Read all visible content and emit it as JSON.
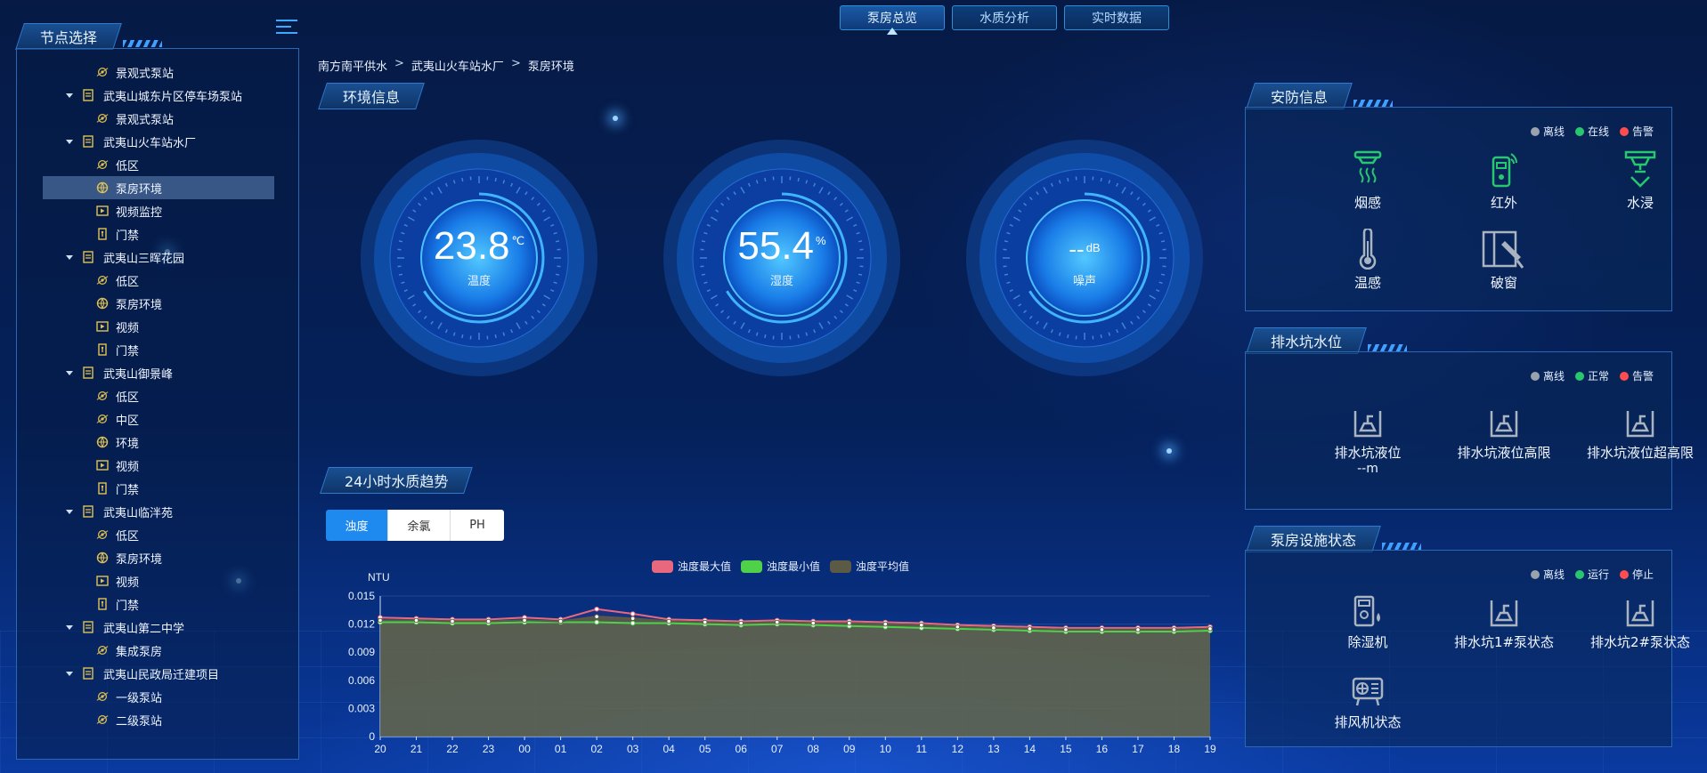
{
  "top_tabs": [
    {
      "label": "泵房总览",
      "active": true
    },
    {
      "label": "水质分析",
      "active": false
    },
    {
      "label": "实时数据",
      "active": false
    }
  ],
  "left": {
    "title": "节点选择",
    "tree": [
      {
        "level": 2,
        "label": "景观式泵站",
        "icon": "pump-icon"
      },
      {
        "level": 1,
        "label": "武夷山城东片区停车场泵站",
        "icon": "folder-icon"
      },
      {
        "level": 2,
        "label": "景观式泵站",
        "icon": "pump-icon"
      },
      {
        "level": 1,
        "label": "武夷山火车站水厂",
        "icon": "folder-icon"
      },
      {
        "level": 2,
        "label": "低区",
        "icon": "pump-icon"
      },
      {
        "level": 2,
        "label": "泵房环境",
        "icon": "environment-icon",
        "selected": true
      },
      {
        "level": 2,
        "label": "视频监控",
        "icon": "video-icon"
      },
      {
        "level": 2,
        "label": "门禁",
        "icon": "door-icon"
      },
      {
        "level": 1,
        "label": "武夷山三晖花园",
        "icon": "folder-icon"
      },
      {
        "level": 2,
        "label": "低区",
        "icon": "pump-icon"
      },
      {
        "level": 2,
        "label": "泵房环境",
        "icon": "environment-icon"
      },
      {
        "level": 2,
        "label": "视频",
        "icon": "video-icon"
      },
      {
        "level": 2,
        "label": "门禁",
        "icon": "door-icon"
      },
      {
        "level": 1,
        "label": "武夷山御景峰",
        "icon": "folder-icon"
      },
      {
        "level": 2,
        "label": "低区",
        "icon": "pump-icon"
      },
      {
        "level": 2,
        "label": "中区",
        "icon": "pump-icon"
      },
      {
        "level": 2,
        "label": "环境",
        "icon": "environment-icon"
      },
      {
        "level": 2,
        "label": "视频",
        "icon": "video-icon"
      },
      {
        "level": 2,
        "label": "门禁",
        "icon": "door-icon"
      },
      {
        "level": 1,
        "label": "武夷山临泮苑",
        "icon": "folder-icon"
      },
      {
        "level": 2,
        "label": "低区",
        "icon": "pump-icon"
      },
      {
        "level": 2,
        "label": "泵房环境",
        "icon": "environment-icon"
      },
      {
        "level": 2,
        "label": "视频",
        "icon": "video-icon"
      },
      {
        "level": 2,
        "label": "门禁",
        "icon": "door-icon"
      },
      {
        "level": 1,
        "label": "武夷山第二中学",
        "icon": "folder-icon"
      },
      {
        "level": 2,
        "label": "集成泵房",
        "icon": "pump-icon"
      },
      {
        "level": 1,
        "label": "武夷山民政局迁建项目",
        "icon": "folder-icon"
      },
      {
        "level": 2,
        "label": "一级泵站",
        "icon": "pump-icon"
      },
      {
        "level": 2,
        "label": "二级泵站",
        "icon": "pump-icon"
      }
    ]
  },
  "breadcrumb": [
    "南方南平供水",
    "武夷山火车站水厂",
    "泵房环境"
  ],
  "env": {
    "title": "环境信息",
    "gauges": [
      {
        "value": "23.8",
        "unit": "℃",
        "label": "温度"
      },
      {
        "value": "55.4",
        "unit": "%",
        "label": "湿度"
      },
      {
        "value": "--",
        "unit": "dB",
        "label": "噪声"
      }
    ]
  },
  "trend": {
    "title": "24小时水质趋势",
    "tabs": [
      {
        "label": "浊度",
        "active": true
      },
      {
        "label": "余氯",
        "active": false
      },
      {
        "label": "PH",
        "active": false
      }
    ]
  },
  "chart_data": {
    "type": "area",
    "ylabel": "NTU",
    "ylim": [
      0,
      0.015
    ],
    "yticks": [
      "0",
      "0.003",
      "0.006",
      "0.009",
      "0.012",
      "0.015"
    ],
    "x": [
      "20",
      "21",
      "22",
      "23",
      "00",
      "01",
      "02",
      "03",
      "04",
      "05",
      "06",
      "07",
      "08",
      "09",
      "10",
      "11",
      "12",
      "13",
      "14",
      "15",
      "16",
      "17",
      "18",
      "19"
    ],
    "legend_position": "top-center",
    "series": [
      {
        "name": "浊度最大值",
        "color": "#e8697e",
        "values": [
          0.0127,
          0.0126,
          0.0125,
          0.0125,
          0.0127,
          0.0125,
          0.0136,
          0.0131,
          0.0125,
          0.0124,
          0.0123,
          0.0124,
          0.0123,
          0.0123,
          0.0122,
          0.0121,
          0.0119,
          0.0118,
          0.0117,
          0.0116,
          0.0116,
          0.0116,
          0.0116,
          0.0117
        ]
      },
      {
        "name": "浊度最小值",
        "color": "#4fd14a",
        "values": [
          0.0122,
          0.0122,
          0.0121,
          0.0121,
          0.0122,
          0.0122,
          0.0122,
          0.0121,
          0.0121,
          0.012,
          0.0119,
          0.012,
          0.0119,
          0.0118,
          0.0117,
          0.0116,
          0.0115,
          0.0114,
          0.0113,
          0.0112,
          0.0112,
          0.0112,
          0.0112,
          0.0113
        ]
      },
      {
        "name": "浊度平均值",
        "color": "#5b5b45",
        "values": [
          0.0124,
          0.0124,
          0.0123,
          0.0123,
          0.0124,
          0.0123,
          0.0128,
          0.0126,
          0.0123,
          0.0122,
          0.0121,
          0.0122,
          0.0121,
          0.0121,
          0.012,
          0.0119,
          0.0117,
          0.0116,
          0.0115,
          0.0114,
          0.0114,
          0.0114,
          0.0114,
          0.0115
        ]
      }
    ]
  },
  "security": {
    "title": "安防信息",
    "legend": [
      {
        "label": "离线",
        "color": "#9aa3ad"
      },
      {
        "label": "在线",
        "color": "#28c76f"
      },
      {
        "label": "告警",
        "color": "#ff4d4f"
      }
    ],
    "devices": [
      {
        "label": "烟感",
        "icon": "smoke-detector-icon",
        "color": "#28c76f"
      },
      {
        "label": "红外",
        "icon": "infrared-sensor-icon",
        "color": "#28c76f"
      },
      {
        "label": "水浸",
        "icon": "water-leak-sensor-icon",
        "color": "#28c76f"
      },
      {
        "label": "温感",
        "icon": "thermometer-icon",
        "color": "#9aa3ad"
      },
      {
        "label": "破窗",
        "icon": "window-break-icon",
        "color": "#9aa3ad"
      }
    ]
  },
  "drain": {
    "title": "排水坑水位",
    "legend": [
      {
        "label": "离线",
        "color": "#9aa3ad"
      },
      {
        "label": "正常",
        "color": "#28c76f"
      },
      {
        "label": "告警",
        "color": "#ff4d4f"
      }
    ],
    "devices": [
      {
        "label": "排水坑液位",
        "sub": "--m",
        "icon": "sump-level-icon"
      },
      {
        "label": "排水坑液位高限",
        "icon": "sump-high-icon"
      },
      {
        "label": "排水坑液位超高限",
        "icon": "sump-overhigh-icon"
      }
    ]
  },
  "facility": {
    "title": "泵房设施状态",
    "legend": [
      {
        "label": "离线",
        "color": "#9aa3ad"
      },
      {
        "label": "运行",
        "color": "#28c76f"
      },
      {
        "label": "停止",
        "color": "#ff4d4f"
      }
    ],
    "devices": [
      {
        "label": "除湿机",
        "icon": "dehumidifier-icon"
      },
      {
        "label": "排水坑1#泵状态",
        "icon": "sump-pump-1-icon"
      },
      {
        "label": "排水坑2#泵状态",
        "icon": "sump-pump-2-icon"
      },
      {
        "label": "排风机状态",
        "icon": "exhaust-fan-icon"
      }
    ]
  }
}
